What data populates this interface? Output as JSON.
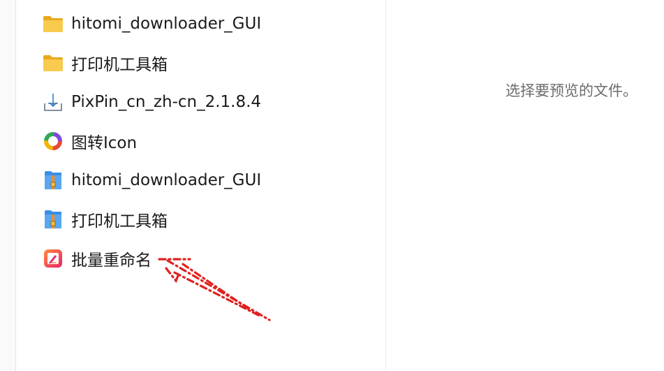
{
  "files": [
    {
      "label": "hitomi_downloader_GUI",
      "icon": "folder-icon"
    },
    {
      "label": "打印机工具箱",
      "icon": "folder-icon"
    },
    {
      "label": "PixPin_cn_zh-cn_2.1.8.4",
      "icon": "installer-download-icon"
    },
    {
      "label": "图转Icon",
      "icon": "colorful-ring-app-icon"
    },
    {
      "label": "hitomi_downloader_GUI",
      "icon": "zip-archive-icon"
    },
    {
      "label": "打印机工具箱",
      "icon": "zip-archive-icon"
    },
    {
      "label": "批量重命名",
      "icon": "batch-rename-app-icon"
    }
  ],
  "preview": {
    "hint": "选择要预览的文件。"
  },
  "colors": {
    "folder": "#f6c343",
    "annotation_arrow": "#e02020",
    "zip_blue": "#3a8ee6",
    "zip_orange": "#f28c28"
  }
}
